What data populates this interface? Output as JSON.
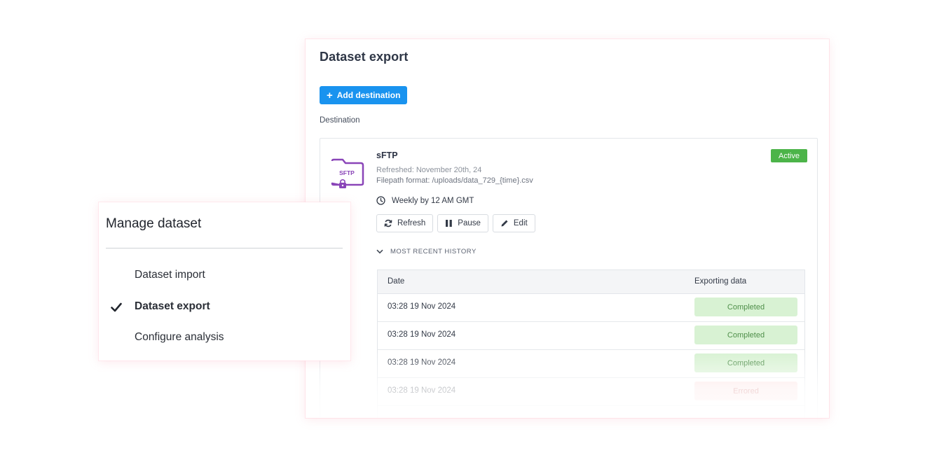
{
  "export_panel": {
    "title": "Dataset export",
    "add_button_label": "Add destination",
    "section_label": "Destination",
    "destination": {
      "name": "sFTP",
      "icon_text": "SFTP",
      "refreshed": "Refreshed: November 20th, 24",
      "filepath": "Filepath format:  /uploads/data_729_{time}.csv",
      "status": "Active",
      "schedule": "Weekly by 12 AM GMT",
      "actions": {
        "refresh": "Refresh",
        "pause": "Pause",
        "edit": "Edit"
      },
      "history_label": "MOST RECENT HISTORY",
      "history": {
        "columns": [
          "Date",
          "Exporting data"
        ],
        "rows": [
          {
            "date": "03:28 19 Nov 2024",
            "status": "Completed"
          },
          {
            "date": "03:28 19 Nov 2024",
            "status": "Completed"
          },
          {
            "date": "03:28 19 Nov 2024",
            "status": "Completed"
          },
          {
            "date": "03:28 19 Nov 2024",
            "status": "Errored"
          }
        ]
      }
    }
  },
  "manage_panel": {
    "title": "Manage dataset",
    "items": [
      {
        "label": "Dataset import",
        "selected": false
      },
      {
        "label": "Dataset export",
        "selected": true
      },
      {
        "label": "Configure analysis",
        "selected": false
      }
    ]
  },
  "colors": {
    "primary": "#1993ef",
    "active_badge": "#4cb449",
    "sftp_icon": "#8a45b8",
    "completed_bg": "#d8f2d3",
    "completed_text": "#4f8f4a",
    "errored_bg": "#fde3e3",
    "errored_text": "#c96a6a"
  }
}
